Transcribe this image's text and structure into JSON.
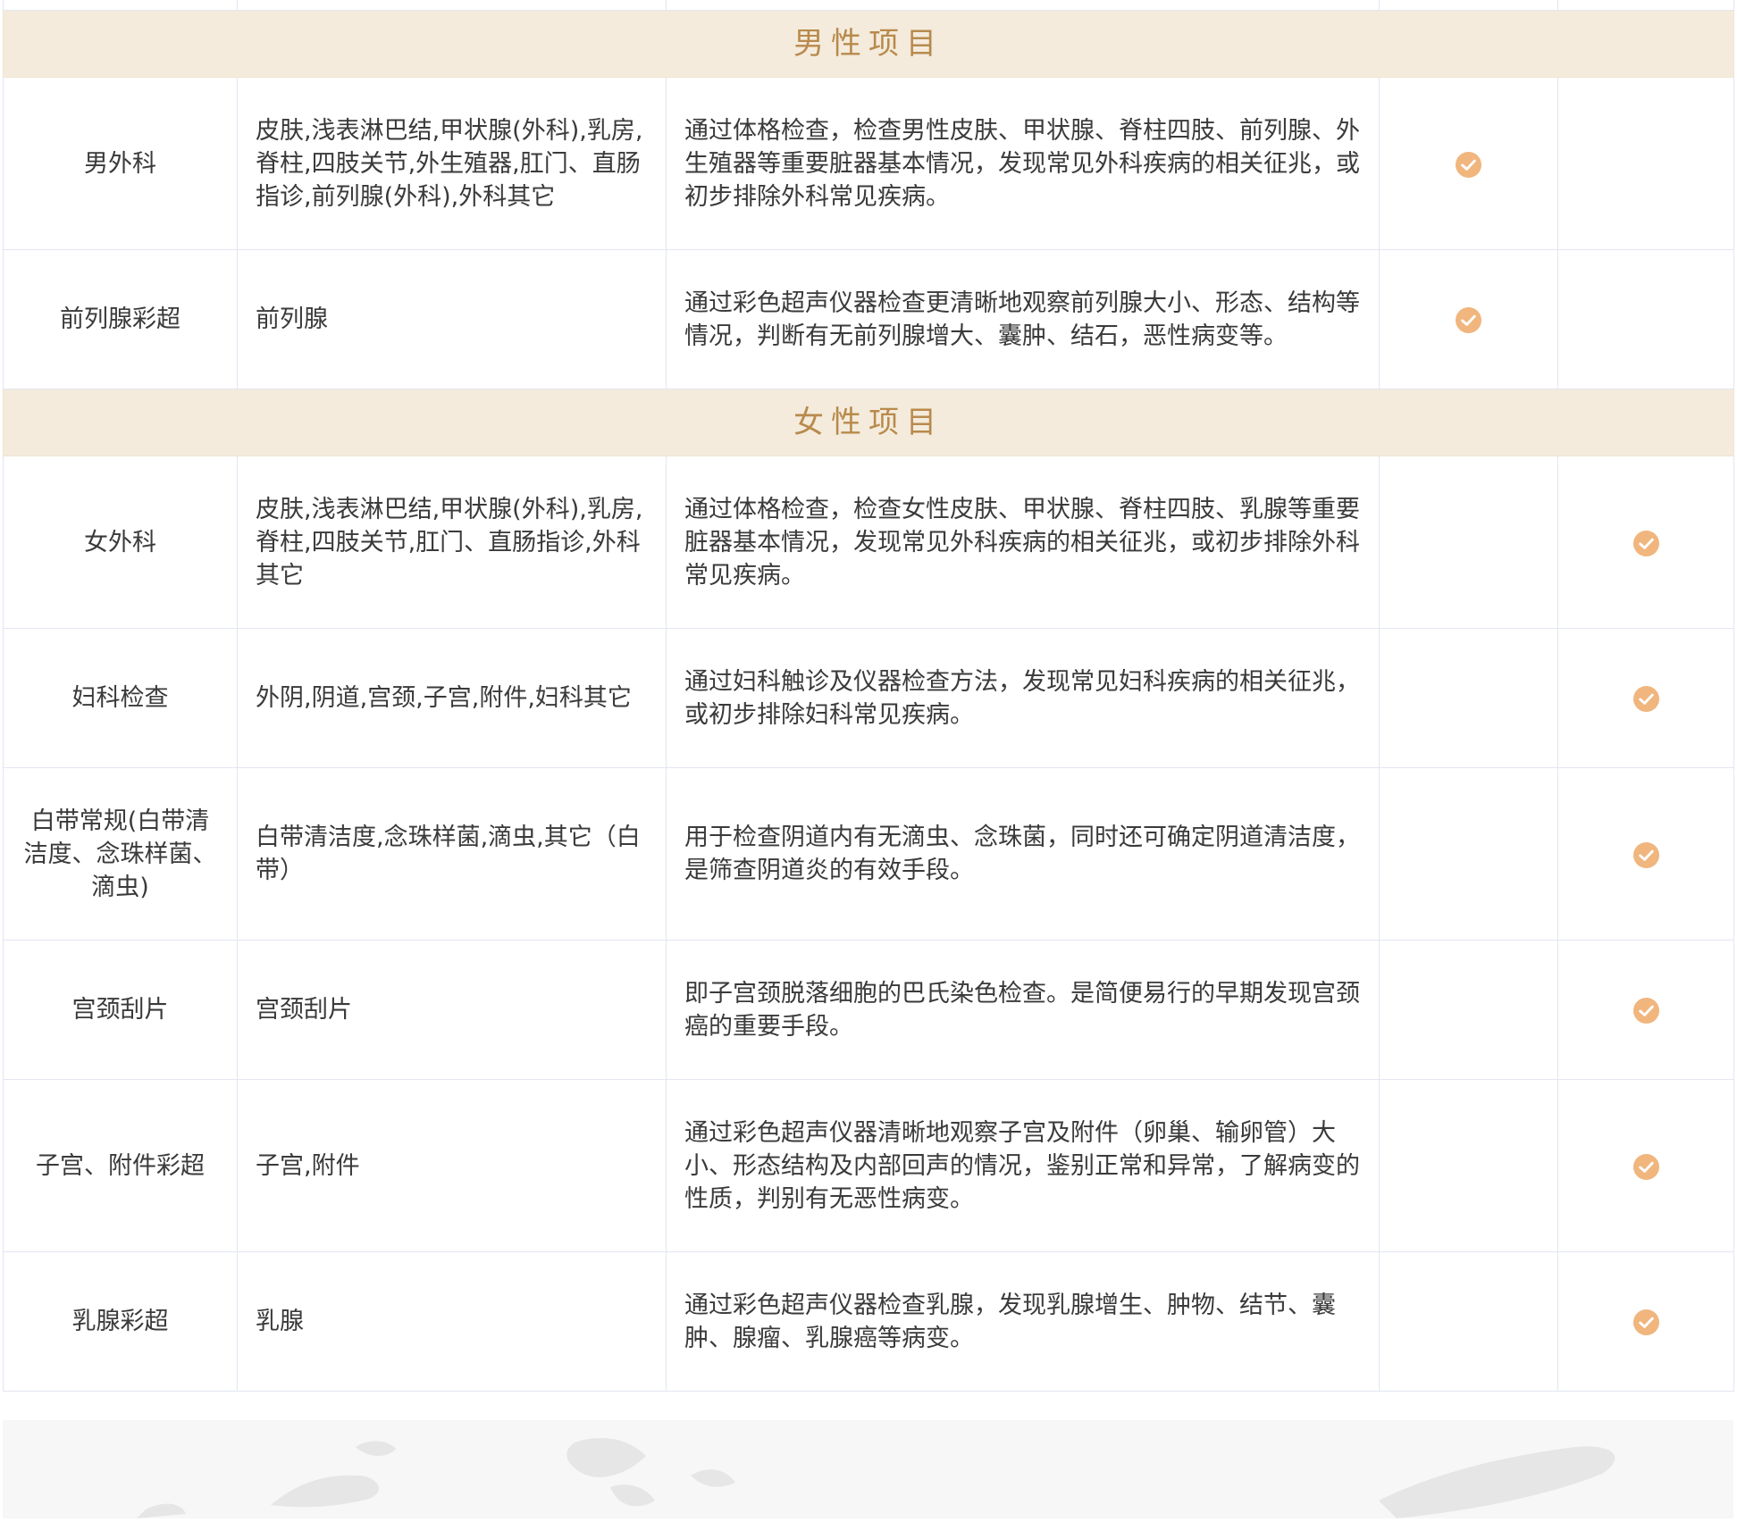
{
  "sections": [
    {
      "title": "男性项目",
      "rows": [
        {
          "name": "男外科",
          "items": "皮肤,浅表淋巴结,甲状腺(外科),乳房,脊柱,四肢关节,外生殖器,肛门、直肠指诊,前列腺(外科),外科其它",
          "description": "通过体格检查，检查男性皮肤、甲状腺、脊柱四肢、前列腺、外生殖器等重要脏器基本情况，发现常见外科疾病的相关征兆，或初步排除外科常见疾病。",
          "male": true,
          "female": false
        },
        {
          "name": "前列腺彩超",
          "items": "前列腺",
          "description": "通过彩色超声仪器检查更清晰地观察前列腺大小、形态、结构等情况，判断有无前列腺增大、囊肿、结石，恶性病变等。",
          "male": true,
          "female": false
        }
      ]
    },
    {
      "title": "女性项目",
      "rows": [
        {
          "name": "女外科",
          "items": "皮肤,浅表淋巴结,甲状腺(外科),乳房,脊柱,四肢关节,肛门、直肠指诊,外科其它",
          "description": "通过体格检查，检查女性皮肤、甲状腺、脊柱四肢、乳腺等重要脏器基本情况，发现常见外科疾病的相关征兆，或初步排除外科常见疾病。",
          "male": false,
          "female": true
        },
        {
          "name": "妇科检查",
          "items": "外阴,阴道,宫颈,子宫,附件,妇科其它",
          "description": "通过妇科触诊及仪器检查方法，发现常见妇科疾病的相关征兆，或初步排除妇科常见疾病。",
          "male": false,
          "female": true
        },
        {
          "name": "白带常规(白带清洁度、念珠样菌、滴虫)",
          "items": "白带清洁度,念珠样菌,滴虫,其它（白带）",
          "description": "用于检查阴道内有无滴虫、念珠菌，同时还可确定阴道清洁度，是筛查阴道炎的有效手段。",
          "male": false,
          "female": true
        },
        {
          "name": "宫颈刮片",
          "items": "宫颈刮片",
          "description": "即子宫颈脱落细胞的巴氏染色检查。是简便易行的早期发现宫颈癌的重要手段。",
          "male": false,
          "female": true
        },
        {
          "name": "子宫、附件彩超",
          "items": "子宫,附件",
          "description": "通过彩色超声仪器清晰地观察子宫及附件（卵巢、输卵管）大小、形态结构及内部回声的情况，鉴别正常和异常，了解病变的性质，判别有无恶性病变。",
          "male": false,
          "female": true
        },
        {
          "name": "乳腺彩超",
          "items": "乳腺",
          "description": "通过彩色超声仪器检查乳腺，发现乳腺增生、肿物、结节、囊肿、腺瘤、乳腺癌等病变。",
          "male": false,
          "female": true
        }
      ]
    }
  ],
  "colors": {
    "section_bg": "#f4ebdc",
    "section_text": "#b88a4c",
    "check": "#f0b67e",
    "border": "#e3e6f2"
  },
  "icons": {
    "check": "check-circle-icon"
  }
}
